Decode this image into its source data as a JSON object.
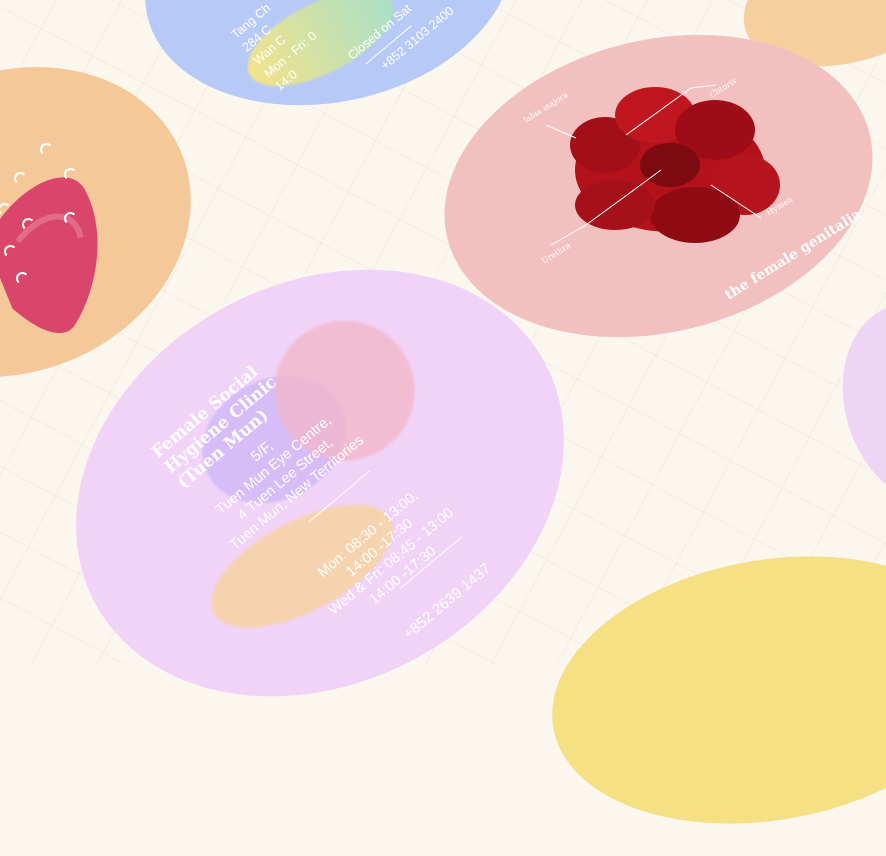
{
  "colors": {
    "background": "#fbf7ef",
    "blue_disc": "#b7c9f6",
    "orange_disc": "#f4c899",
    "pink_disc": "#f3c0c0",
    "lilac_disc": "#f0d3f7",
    "yellow_disc": "#f6e084",
    "flower": "#b3121b",
    "text": "#ffffff"
  },
  "blue_card": {
    "line1": "Tang Ch",
    "line2": "284 C",
    "line3": "Wan C",
    "line4": "Mon - Fri: 0",
    "line5": "14:0",
    "closed": "Closed on Sat",
    "phone": "+852 3103 2400"
  },
  "flower_card": {
    "caption": "the female genitalia",
    "labels": {
      "labia": "labia majora",
      "clitoris": "Clitoris",
      "urethra": "Urethra",
      "hymen": "Hymen"
    }
  },
  "clinic_card": {
    "title_lines": [
      "Female Social",
      "Hygiene Clinic",
      "(Tuen Mun)"
    ],
    "address_lines": [
      "5/F,",
      "Tuen Mun Eye Centre,",
      "4 Tuen Lee Street,",
      "Tuen Mun, New Territories"
    ],
    "hours_lines": [
      "Mon: 08:30 - 13:00,",
      "14:00 -17:30",
      "Wed & Fri: 08:45 - 13:00",
      "14:00 -17:30"
    ],
    "phone": "+852 2639 1437"
  }
}
